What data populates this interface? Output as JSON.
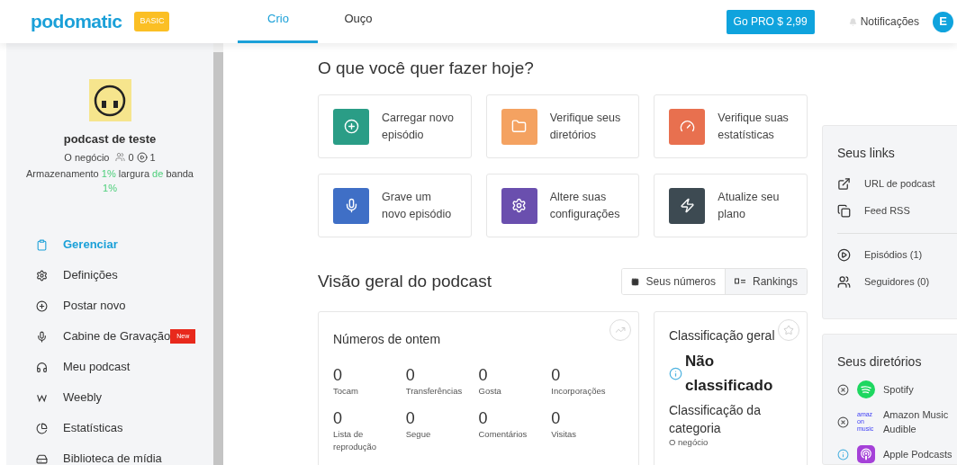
{
  "header": {
    "logo": "podomatic",
    "plan_badge": "BASIC",
    "tabs": [
      {
        "label": "Crio",
        "selected": true
      },
      {
        "label": "Ouço",
        "selected": false
      }
    ],
    "pro_button": "Go PRO $ 2,99",
    "notifications": "Notificações",
    "avatar": "E"
  },
  "sidebar": {
    "podcast": {
      "title": "podcast de teste",
      "category": "O negócio",
      "followers": "0",
      "episodes": "1",
      "usage": [
        {
          "text": "Armazenamento",
          "highlight": false
        },
        {
          "text": "1%",
          "highlight": true
        },
        {
          "text": "largura",
          "highlight": false
        },
        {
          "text": "de",
          "highlight": true
        },
        {
          "text": "banda",
          "highlight": false
        },
        {
          "text": "1%",
          "highlight": true
        }
      ]
    },
    "items": [
      {
        "label": "Gerenciar",
        "selected": true
      },
      {
        "label": "Definições",
        "selected": false
      },
      {
        "label": "Postar novo",
        "selected": false
      },
      {
        "label": "Cabine de Gravação",
        "selected": false,
        "badge": "New"
      },
      {
        "label": "Meu podcast",
        "selected": false
      },
      {
        "label": "Weebly",
        "selected": false
      },
      {
        "label": "Estatísticas",
        "selected": false
      },
      {
        "label": "Biblioteca de mídia",
        "selected": false
      }
    ]
  },
  "main": {
    "heading": "O que você quer fazer hoje?",
    "actions": [
      {
        "label": "Carregar novo episódio",
        "color": "#2a9d86"
      },
      {
        "label": "Verifique seus diretórios",
        "color": "#f4a261"
      },
      {
        "label": "Verifique suas estatísticas",
        "color": "#e8704f"
      },
      {
        "label": "Grave um novo episódio",
        "color": "#3f6fc6"
      },
      {
        "label": "Altere suas configurações",
        "color": "#6a4fae"
      },
      {
        "label": "Atualize seu plano",
        "color": "#3d4a52"
      }
    ],
    "overview_heading": "Visão geral do podcast",
    "view_toggle": [
      {
        "label": "Seus números",
        "selected": true
      },
      {
        "label": "Rankings",
        "selected": false
      }
    ],
    "numbers": {
      "title": "Números de ontem",
      "stats": [
        {
          "value": "0",
          "label": "Tocam"
        },
        {
          "value": "0",
          "label": "Transferências"
        },
        {
          "value": "0",
          "label": "Gosta"
        },
        {
          "value": "0",
          "label": "Incorporações"
        },
        {
          "value": "0",
          "label": "Lista de reprodução"
        },
        {
          "value": "0",
          "label": "Segue"
        },
        {
          "value": "0",
          "label": "Comentários"
        },
        {
          "value": "0",
          "label": "Visitas"
        }
      ]
    },
    "ranking": {
      "title": "Classificação geral",
      "status": "Não classificado",
      "category_title": "Classificação da categoria",
      "category": "O negócio"
    }
  },
  "right": {
    "links_title": "Seus links",
    "links": [
      {
        "label": "URL de podcast"
      },
      {
        "label": "Feed RSS"
      }
    ],
    "counts": [
      {
        "label": "Episódios (1)"
      },
      {
        "label": "Seguidores (0)"
      }
    ],
    "directories_title": "Seus diretórios",
    "directories": [
      {
        "label": "Spotify",
        "kind": "spotify",
        "pending": false
      },
      {
        "label": "Amazon Music",
        "kind": "amazon",
        "logo_text": "amazon music",
        "pending": false,
        "second_line": "Audible"
      },
      {
        "label": "Apple Podcasts",
        "kind": "apple",
        "pending": true
      }
    ]
  }
}
